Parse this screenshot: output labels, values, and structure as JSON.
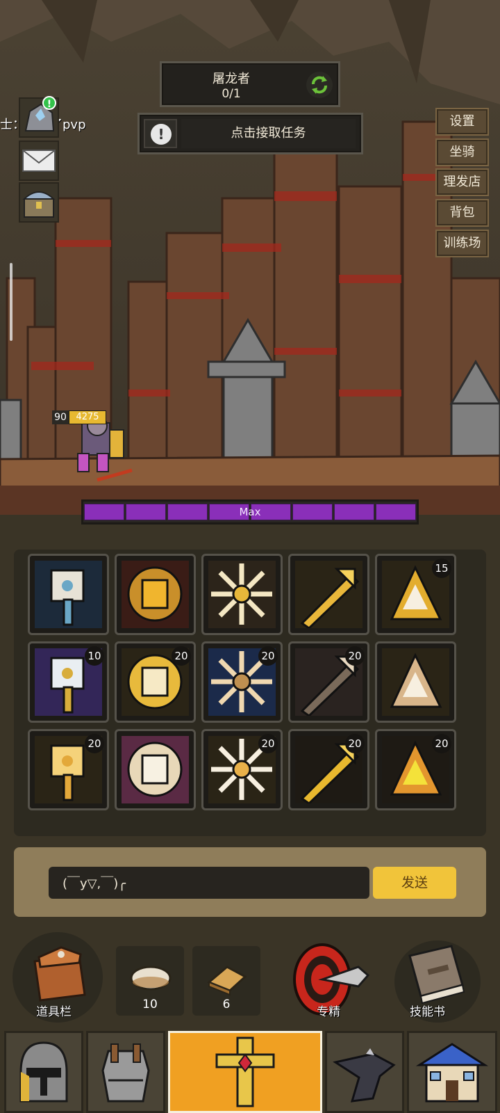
{
  "quest": {
    "boss_name": "屠龙者",
    "boss_progress": "0/1",
    "task_prompt": "点击接取任务"
  },
  "left_panel": {
    "notification_badge": "!",
    "news_text": "士：更新了pvp"
  },
  "menu": {
    "settings": "设置",
    "mount": "坐骑",
    "barber": "理发店",
    "bag": "背包",
    "training": "训练场"
  },
  "player": {
    "level": "90",
    "hp_text": "4275",
    "hp_fill_fraction": 1.0,
    "xp_label": "Max",
    "xp_segments": 8,
    "xp_fill_fraction": 1.0
  },
  "skills": [
    {
      "icon": "hammer-icon",
      "level": "",
      "colors": [
        "#1c2a3a",
        "#6aa7c6",
        "#e7e2d6"
      ]
    },
    {
      "icon": "fist-icon",
      "level": "",
      "colors": [
        "#3a1c16",
        "#c98f2a",
        "#f0b52e"
      ]
    },
    {
      "icon": "ground-burst-icon",
      "level": "",
      "colors": [
        "#2c241a",
        "#e7b73a",
        "#f4e7c3"
      ]
    },
    {
      "icon": "trident-icon",
      "level": "",
      "colors": [
        "#2a2416",
        "#e9b73a",
        "#f6d25b"
      ]
    },
    {
      "icon": "sword-fan-icon",
      "level": "15",
      "colors": [
        "#2a2416",
        "#e3ad2e",
        "#f7efe0"
      ]
    },
    {
      "icon": "knight-helmet-icon",
      "level": "10",
      "colors": [
        "#332658",
        "#d8ad3c",
        "#e9eef2"
      ]
    },
    {
      "icon": "horse-head-icon",
      "level": "20",
      "colors": [
        "#2a2416",
        "#e8ba3c",
        "#f6e9c5"
      ]
    },
    {
      "icon": "lightning-hammer-icon",
      "level": "20",
      "colors": [
        "#1b2a4a",
        "#c09050",
        "#f0d8b0"
      ]
    },
    {
      "icon": "crushing-hammer-icon",
      "level": "20",
      "colors": [
        "#2a2320",
        "#7a6a5a",
        "#e8d8c0"
      ]
    },
    {
      "icon": "open-hand-icon",
      "level": "",
      "colors": [
        "#2a2416",
        "#d8b58a",
        "#f7efe0"
      ]
    },
    {
      "icon": "play-hammer-icon",
      "level": "20",
      "colors": [
        "#2a2416",
        "#e3a83a",
        "#f5d27a"
      ]
    },
    {
      "icon": "white-mallet-icon",
      "level": "",
      "colors": [
        "#5a2a44",
        "#e8d8b8",
        "#f7f1e2"
      ]
    },
    {
      "icon": "shatter-icon",
      "level": "20",
      "colors": [
        "#2a2416",
        "#e8b04a",
        "#f7efe0"
      ]
    },
    {
      "icon": "spiral-sword-icon",
      "level": "20",
      "colors": [
        "#1e1a14",
        "#e8b82e",
        "#f6d25b"
      ]
    },
    {
      "icon": "flaming-hammer-icon",
      "level": "20",
      "colors": [
        "#1e1a14",
        "#e3962e",
        "#f4e23a"
      ]
    }
  ],
  "chat": {
    "input_value": "(￣y▽,￣)╭",
    "send_label": "发送"
  },
  "actions": {
    "items_label": "道具栏",
    "bread_count": "10",
    "toast_count": "6",
    "mastery_label": "专精",
    "skill_book_label": "技能书"
  },
  "tabs": [
    "helmet-icon",
    "armor-icon",
    "weapon-icon",
    "anvil-icon",
    "shop-icon"
  ],
  "colors": {
    "accent_yellow": "#f1c43a",
    "xp_purple": "#8a2fb9",
    "active_tab": "#f0a022",
    "panel_dark": "#2d2a20"
  }
}
